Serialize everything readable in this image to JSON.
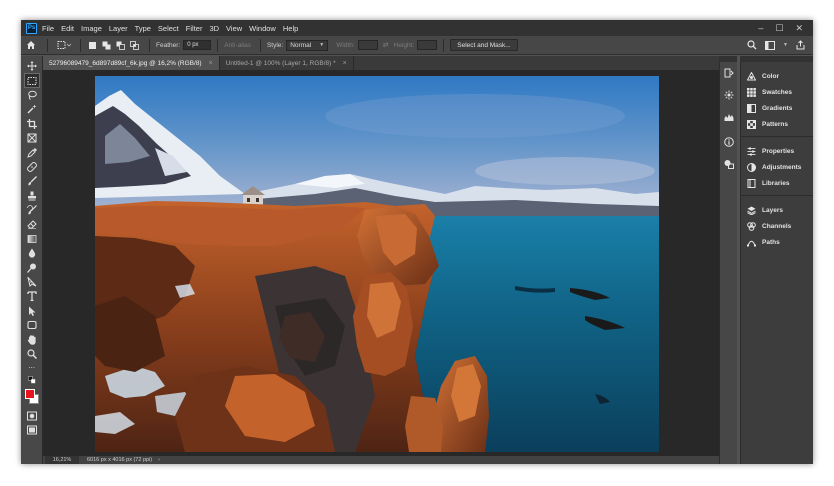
{
  "app": {
    "logo": "Ps",
    "menu": [
      "File",
      "Edit",
      "Image",
      "Layer",
      "Type",
      "Select",
      "Filter",
      "3D",
      "View",
      "Window",
      "Help"
    ],
    "window_controls": [
      "–",
      "☐",
      "✕"
    ]
  },
  "options": {
    "feather_label": "Feather:",
    "feather_value": "0 px",
    "anti_alias_label": "Anti-alias",
    "style_label": "Style:",
    "style_value": "Normal",
    "width_label": "Width:",
    "height_label": "Height:",
    "select_mask_button": "Select and Mask..."
  },
  "tabs": [
    {
      "label": "527960894​79_6d897d89cf_6k.jpg @ 16,2% (RGB/8)",
      "close": "×",
      "active": true
    },
    {
      "label": "Untitled-1 @ 100% (Layer 1, RGB/8) *",
      "close": "×",
      "active": false
    }
  ],
  "status": {
    "zoom": "16,21%",
    "info": "6016 px x 4016 px (72 ppi)",
    "arrow": "›"
  },
  "panels": {
    "group1": [
      {
        "icon": "color-icon",
        "label": "Color"
      },
      {
        "icon": "swatches-icon",
        "label": "Swatches"
      },
      {
        "icon": "gradients-icon",
        "label": "Gradients"
      },
      {
        "icon": "patterns-icon",
        "label": "Patterns"
      }
    ],
    "group2": [
      {
        "icon": "properties-icon",
        "label": "Properties"
      },
      {
        "icon": "adjustments-icon",
        "label": "Adjustments"
      },
      {
        "icon": "libraries-icon",
        "label": "Libraries"
      }
    ],
    "group3": [
      {
        "icon": "layers-icon",
        "label": "Layers"
      },
      {
        "icon": "channels-icon",
        "label": "Channels"
      },
      {
        "icon": "paths-icon",
        "label": "Paths"
      }
    ]
  },
  "colors": {
    "foreground": "#e8141b",
    "background": "#ffffff",
    "accent": "#31a8ff"
  }
}
